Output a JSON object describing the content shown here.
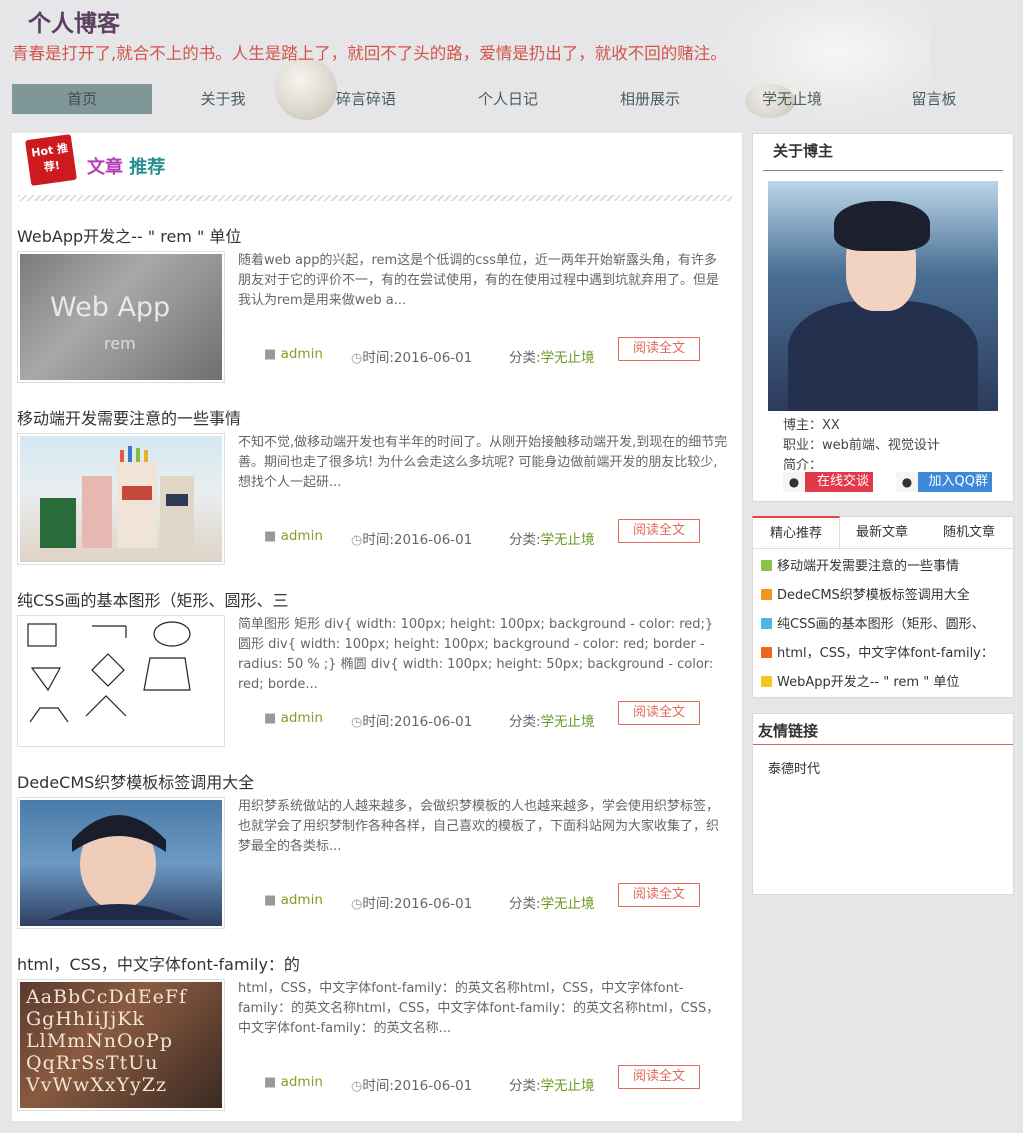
{
  "site": {
    "title": "个人博客",
    "slogan": "青春是打开了,就合不上的书。人生是踏上了，就回不了头的路，爱情是扔出了，就收不回的赌注。"
  },
  "nav": {
    "items": [
      "首页",
      "关于我",
      "碎言碎语",
      "个人日记",
      "相册展示",
      "学无止境",
      "留言板"
    ],
    "active": "首页"
  },
  "section": {
    "badge": "Hot 推荐!",
    "title_part1": "文章",
    "title_part2": "推荐"
  },
  "articles": [
    {
      "title": "WebApp开发之-- \" rem \" 单位",
      "excerpt": "随着web app的兴起，rem这是个低调的css单位，近一两年开始崭露头角，有许多朋友对于它的评价不一，有的在尝试使用，有的在使用过程中遇到坑就弃用了。但是我认为rem是用来做web a...",
      "author": "admin",
      "time": "时间:2016-06-01",
      "cat_label": "分类:",
      "cat_value": "学无止境",
      "read": "阅读全文",
      "thumb_text_big": "Web App",
      "thumb_text_small": "rem"
    },
    {
      "title": "移动端开发需要注意的一些事情",
      "excerpt": "不知不觉,做移动端开发也有半年的时间了。从刚开始接触移动端开发,到现在的细节完善。期间也走了很多坑! 为什么会走这么多坑呢? 可能身边做前端开发的朋友比较少,想找个人一起研...",
      "author": "admin",
      "time": "时间:2016-06-01",
      "cat_label": "分类:",
      "cat_value": "学无止境",
      "read": "阅读全文"
    },
    {
      "title": "纯CSS画的基本图形（矩形、圆形、三",
      "excerpt": "简单图形 矩形 div{ width: 100px; height: 100px; background - color: red;} 圆形 div{ width: 100px; height: 100px; background - color: red; border -radius: 50 % ;} 椭圆 div{ width: 100px; height: 50px; background - color: red; borde...",
      "author": "admin",
      "time": "时间:2016-06-01",
      "cat_label": "分类:",
      "cat_value": "学无止境",
      "read": "阅读全文"
    },
    {
      "title": "DedeCMS织梦模板标签调用大全",
      "excerpt": "用织梦系统做站的人越来越多，会做织梦模板的人也越来越多，学会使用织梦标签，也就学会了用织梦制作各种各样，自己喜欢的模板了，下面科站网为大家收集了，织梦最全的各类标...",
      "author": "admin",
      "time": "时间:2016-06-01",
      "cat_label": "分类:",
      "cat_value": "学无止境",
      "read": "阅读全文"
    },
    {
      "title": "html，CSS，中文字体font-family：的",
      "excerpt": "html，CSS，中文字体font-family：的英文名称html，CSS，中文字体font-family：的英文名称html，CSS，中文字体font-family：的英文名称html，CSS，中文字体font-family：的英文名称...",
      "author": "admin",
      "time": "时间:2016-06-01",
      "cat_label": "分类:",
      "cat_value": "学无止境",
      "read": "阅读全文",
      "thumb_letters": "AaBbCcDdEeFf GgHhIiJjKk LlMmNnOoPp QqRrSsTtUu VvWwXxYyZz"
    }
  ],
  "about": {
    "title": "关于博主",
    "blogger": "博主：XX",
    "job": "职业：web前端、视觉设计",
    "intro": "简介：",
    "chat_btn": "在线交谈",
    "qq_btn": "加入QQ群"
  },
  "recommend": {
    "tabs": [
      "精心推荐",
      "最新文章",
      "随机文章"
    ],
    "active_tab": "精心推荐",
    "items": [
      {
        "text": "移动端开发需要注意的一些事情",
        "color": "#8bc34a"
      },
      {
        "text": "DedeCMS织梦模板标签调用大全",
        "color": "#f0961e"
      },
      {
        "text": "纯CSS画的基本图形（矩形、圆形、",
        "color": "#4cb6e4"
      },
      {
        "text": "html，CSS，中文字体font-family：",
        "color": "#f0651e"
      },
      {
        "text": "WebApp开发之-- \" rem \" 单位",
        "color": "#f0c81e"
      }
    ]
  },
  "links": {
    "title": "友情链接",
    "items": [
      "泰德时代"
    ]
  }
}
